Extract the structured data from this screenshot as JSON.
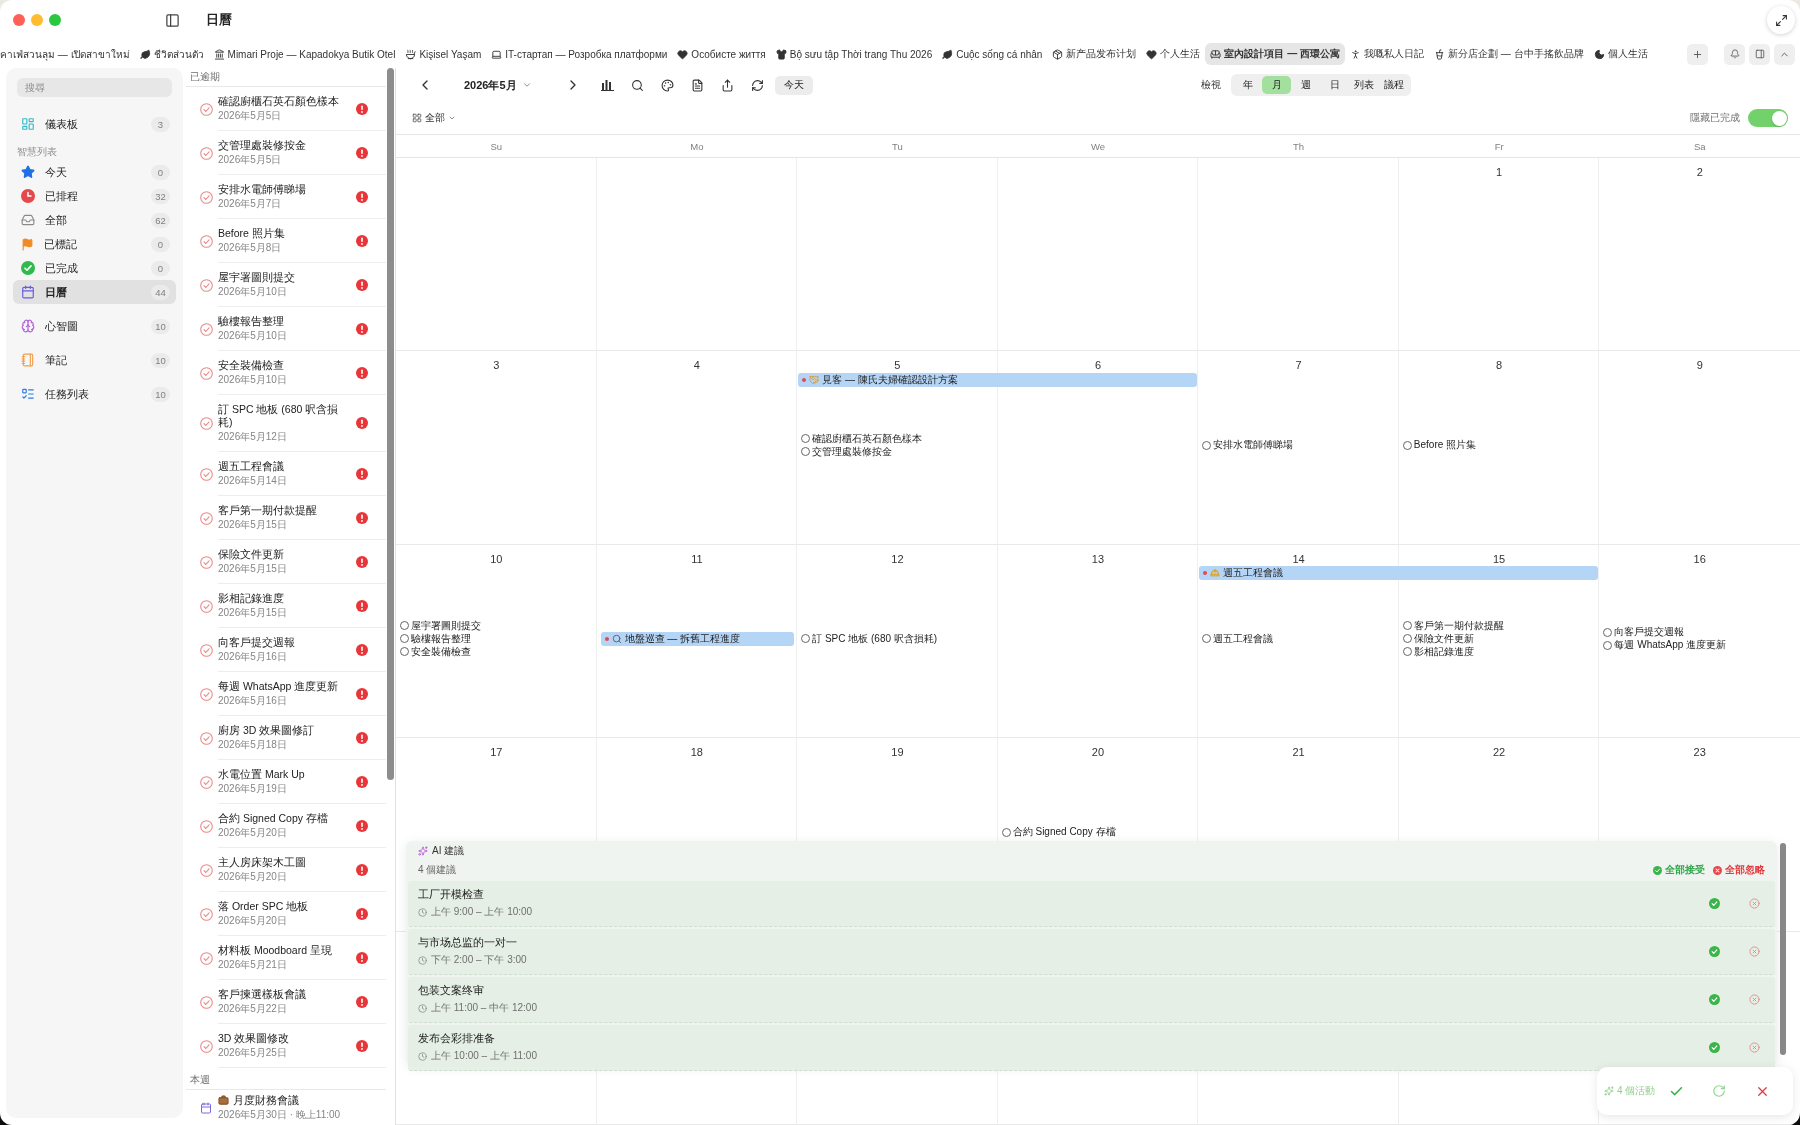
{
  "window": {
    "title": "日曆"
  },
  "tabs": [
    {
      "label": "คาเฟ่สวนลุม — เปิดสาขาใหม่",
      "selected": false
    },
    {
      "label": "ชีวิตส่วนตัว",
      "kind": "leaf",
      "selected": false
    },
    {
      "label": "Mimari Proje — Kapadokya Butik Otel",
      "kind": "landmark",
      "selected": false
    },
    {
      "label": "Kişisel Yaşam",
      "kind": "bowl",
      "selected": false
    },
    {
      "label": "IT-стартап — Розробка платформи",
      "kind": "laptop",
      "selected": false
    },
    {
      "label": "Особисте життя",
      "kind": "heart",
      "selected": false
    },
    {
      "label": "Bộ sưu tập Thời trang Thu 2026",
      "kind": "shirt",
      "selected": false
    },
    {
      "label": "Cuộc sống cá nhân",
      "kind": "leaf",
      "selected": false
    },
    {
      "label": "新产品发布计划",
      "kind": "package",
      "selected": false
    },
    {
      "label": "个人生活",
      "kind": "heart",
      "selected": false
    },
    {
      "label": "室內設計項目 — 西環公寓",
      "kind": "sofa",
      "selected": true
    },
    {
      "label": "我嘅私人日記",
      "kind": "person",
      "selected": false
    },
    {
      "label": "新分店企劃 — 台中手搖飲品牌",
      "kind": "cup",
      "selected": false
    },
    {
      "label": "個人生活",
      "kind": "moon",
      "selected": false
    }
  ],
  "sidebar": {
    "search": {
      "placeholder": "搜尋"
    },
    "groups": [
      {
        "items": [
          {
            "label": "儀表板",
            "count": "3",
            "kind": "dashboard",
            "selected": false
          }
        ]
      },
      {
        "title": "智慧列表",
        "items": [
          {
            "label": "今天",
            "count": "0",
            "kind": "today",
            "selected": false
          },
          {
            "label": "已排程",
            "count": "32",
            "kind": "scheduled",
            "selected": false
          },
          {
            "label": "全部",
            "count": "62",
            "kind": "all",
            "selected": false
          },
          {
            "label": "已標記",
            "count": "0",
            "kind": "flagged",
            "selected": false
          },
          {
            "label": "已完成",
            "count": "0",
            "kind": "completed",
            "selected": false
          },
          {
            "label": "日曆",
            "count": "44",
            "kind": "calendar",
            "selected": true
          }
        ]
      },
      {
        "items": [
          {
            "label": "心智圖",
            "count": "10",
            "kind": "mindmap",
            "selected": false
          }
        ]
      },
      {
        "items": [
          {
            "label": "筆記",
            "count": "10",
            "kind": "notes",
            "selected": false
          }
        ]
      },
      {
        "items": [
          {
            "label": "任務列表",
            "count": "10",
            "kind": "tasklist",
            "selected": false
          }
        ]
      }
    ]
  },
  "task_list": {
    "sections": [
      {
        "title": "已逾期",
        "items": [
          {
            "kind": "task",
            "title": "確認廚櫃石英石顏色樣本",
            "date": "2026年5月5日",
            "checked": false
          },
          {
            "kind": "task",
            "title": "交管理處裝修按金",
            "date": "2026年5月5日",
            "checked": false
          },
          {
            "kind": "task",
            "title": "安排水電師傅睇場",
            "date": "2026年5月7日",
            "checked": false
          },
          {
            "kind": "task",
            "title": "Before 照片集",
            "date": "2026年5月8日",
            "checked": false
          },
          {
            "kind": "task",
            "title": "屋宇署圖則提交",
            "date": "2026年5月10日",
            "checked": false
          },
          {
            "kind": "task",
            "title": "驗樓報告整理",
            "date": "2026年5月10日",
            "checked": false
          },
          {
            "kind": "task",
            "title": "安全裝備檢查",
            "date": "2026年5月10日",
            "checked": false
          },
          {
            "kind": "task",
            "title": "訂 SPC 地板 (680 呎含損耗)",
            "date": "2026年5月12日",
            "checked": false
          },
          {
            "kind": "task",
            "title": "週五工程會議",
            "date": "2026年5月14日",
            "checked": false
          },
          {
            "kind": "task",
            "title": "客戶第一期付款提醒",
            "date": "2026年5月15日",
            "checked": false
          },
          {
            "kind": "task",
            "title": "保險文件更新",
            "date": "2026年5月15日",
            "checked": false
          },
          {
            "kind": "task",
            "title": "影相記錄進度",
            "date": "2026年5月15日",
            "checked": false
          },
          {
            "kind": "task",
            "title": "向客戶提交週報",
            "date": "2026年5月16日",
            "checked": false
          },
          {
            "kind": "task",
            "title": "每週 WhatsApp 進度更新",
            "date": "2026年5月16日",
            "checked": false
          },
          {
            "kind": "task",
            "title": "廚房 3D 效果圖修訂",
            "date": "2026年5月18日",
            "checked": false
          },
          {
            "kind": "task",
            "title": "水電位置 Mark Up",
            "date": "2026年5月19日",
            "checked": false
          },
          {
            "kind": "task",
            "title": "合約 Signed Copy 存檔",
            "date": "2026年5月20日",
            "checked": false
          },
          {
            "kind": "task",
            "title": "主人房床架木工圖",
            "date": "2026年5月20日",
            "checked": false
          },
          {
            "kind": "task",
            "title": "落 Order SPC 地板",
            "date": "2026年5月20日",
            "checked": false
          },
          {
            "kind": "task",
            "title": "材料板 Moodboard 呈現",
            "date": "2026年5月21日",
            "checked": false
          },
          {
            "kind": "task",
            "title": "客戶揀選樣板會議",
            "date": "2026年5月22日",
            "checked": false
          },
          {
            "kind": "task",
            "title": "3D 效果圖修改",
            "date": "2026年5月25日",
            "checked": false
          }
        ]
      },
      {
        "title": "本週",
        "items": [
          {
            "kind": "event",
            "title": "月度財務會議",
            "date": "2026年5月30日 · 晚上11:00"
          }
        ]
      }
    ]
  },
  "calendar": {
    "month_label": "2026年5月",
    "today_button": "今天",
    "view": {
      "label": "檢視",
      "options": [
        {
          "label": "年",
          "selected": false
        },
        {
          "label": "月",
          "selected": true
        },
        {
          "label": "週",
          "selected": false
        },
        {
          "label": "日",
          "selected": false
        },
        {
          "label": "列表",
          "selected": false
        },
        {
          "label": "議程",
          "selected": false
        }
      ]
    },
    "filter": {
      "label": "全部"
    },
    "hide_completed": {
      "label": "隱藏已完成",
      "on": true
    },
    "weekdays": [
      "Su",
      "Mo",
      "Tu",
      "We",
      "Th",
      "Fr",
      "Sa"
    ],
    "weeks": [
      {
        "days": [
          {
            "date": "1"
          },
          {
            "date": "2"
          }
        ]
      },
      {
        "days": [
          {
            "date": "3"
          },
          {
            "date": "4"
          },
          {
            "date": "5",
            "bar": {
              "title": "見客 — 陳氏夫婦確認設計方案",
              "kind": "handshake"
            },
            "items": [
              {
                "kind": "task",
                "title": "確認廚櫃石英石顏色樣本",
                "checked": false
              },
              {
                "kind": "task",
                "title": "交管理處裝修按金",
                "checked": false
              }
            ]
          },
          {
            "date": "6",
            "bar_continues": true
          },
          {
            "date": "7",
            "items": [
              {
                "kind": "task",
                "title": "安排水電師傅睇場",
                "checked": false
              }
            ]
          },
          {
            "date": "8",
            "items": [
              {
                "kind": "task",
                "title": "Before 照片集",
                "checked": false
              }
            ]
          },
          {
            "date": "9"
          }
        ]
      },
      {
        "days": [
          {
            "date": "10",
            "items": [
              {
                "kind": "task",
                "title": "屋宇署圖則提交",
                "checked": false
              },
              {
                "kind": "task",
                "title": "驗樓報告整理",
                "checked": false
              },
              {
                "kind": "task",
                "title": "安全裝備檢查",
                "checked": false
              }
            ]
          },
          {
            "date": "11",
            "items": [
              {
                "kind": "inspection",
                "title": "地盤巡查 — 拆舊工程進度"
              }
            ]
          },
          {
            "date": "12",
            "items": [
              {
                "kind": "task",
                "title": "訂 SPC 地板 (680 呎含損耗)",
                "checked": false
              }
            ]
          },
          {
            "date": "13"
          },
          {
            "date": "14",
            "bar": {
              "title": "週五工程會議",
              "kind": "construction"
            },
            "items": [
              {
                "kind": "task",
                "title": "週五工程會議",
                "checked": false
              }
            ]
          },
          {
            "date": "15",
            "bar_continues": true,
            "items": [
              {
                "kind": "task",
                "title": "客戶第一期付款提醒",
                "checked": false
              },
              {
                "kind": "task",
                "title": "保險文件更新",
                "checked": false
              },
              {
                "kind": "task",
                "title": "影相記錄進度",
                "checked": false
              }
            ]
          },
          {
            "date": "16",
            "items": [
              {
                "kind": "task",
                "title": "向客戶提交週報",
                "checked": false
              },
              {
                "kind": "task",
                "title": "每週 WhatsApp 進度更新",
                "checked": false
              }
            ]
          }
        ]
      },
      {
        "days": [
          {
            "date": "17"
          },
          {
            "date": "18"
          },
          {
            "date": "19"
          },
          {
            "date": "20",
            "items": [
              {
                "kind": "task",
                "title": "合約 Signed Copy 存檔",
                "checked": false
              }
            ]
          },
          {
            "date": "21"
          },
          {
            "date": "22"
          },
          {
            "date": "23"
          }
        ]
      }
    ]
  },
  "ai_panel": {
    "title": "AI 建議",
    "count_label": "4 個建議",
    "accept_all": "全部接受",
    "dismiss_all": "全部忽略",
    "suggestions": [
      {
        "title": "工厂开模检查",
        "time": "上午 9:00 – 上午 10:00"
      },
      {
        "title": "与市场总监的一对一",
        "time": "下午 2:00 – 下午 3:00"
      },
      {
        "title": "包装文案终审",
        "time": "上午 11:00 – 中午 12:00"
      },
      {
        "title": "发布会彩排准备",
        "time": "上午 10:00 – 上午 11:00"
      }
    ]
  },
  "activity_bar": {
    "label": "4 個活動"
  }
}
